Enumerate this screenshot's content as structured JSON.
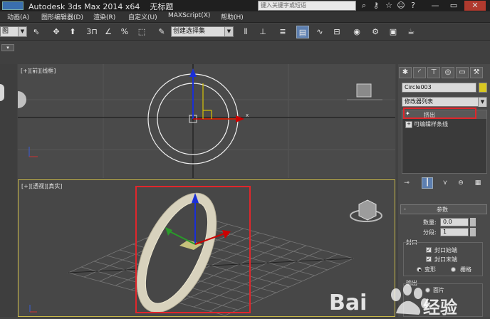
{
  "title_bar": {
    "app_title": "Autodesk 3ds Max  2014 x64",
    "doc_title": "无标题",
    "search_placeholder": "键入关键字或短语"
  },
  "menu": [
    "动画(A)",
    "图形编辑器(D)",
    "渲染(R)",
    "自定义(U)",
    "MAXScript(X)",
    "帮助(H)"
  ],
  "toolbar": {
    "left_dropdown": "图",
    "ref_coord": "视图",
    "snap_3": "3",
    "pct": "%",
    "named_selection": "创建选择集"
  },
  "viewports": {
    "top_label": "[+][前][线框]",
    "persp_label": "[+][透视][真实]",
    "axis_x": "x"
  },
  "command_panel": {
    "object_name": "Circle003",
    "modifier_list": "修改器列表",
    "stack": [
      "挤出",
      "可编辑样条线"
    ],
    "rollout_title": "参数",
    "amount_label": "数量:",
    "amount_value": "0.0",
    "segments_label": "分段:",
    "segments_value": "1",
    "capping_label": "封口",
    "cap_start": "封口始端",
    "cap_end": "封口末端",
    "morph": "变形",
    "grid": "栅格",
    "output_label": "输出",
    "output_patch": "面片"
  },
  "watermark": {
    "brand": "Bai",
    "suffix": "经验"
  },
  "colors": {
    "highlight_red": "#e0262b",
    "selected_blue": "#5d7fb0"
  }
}
